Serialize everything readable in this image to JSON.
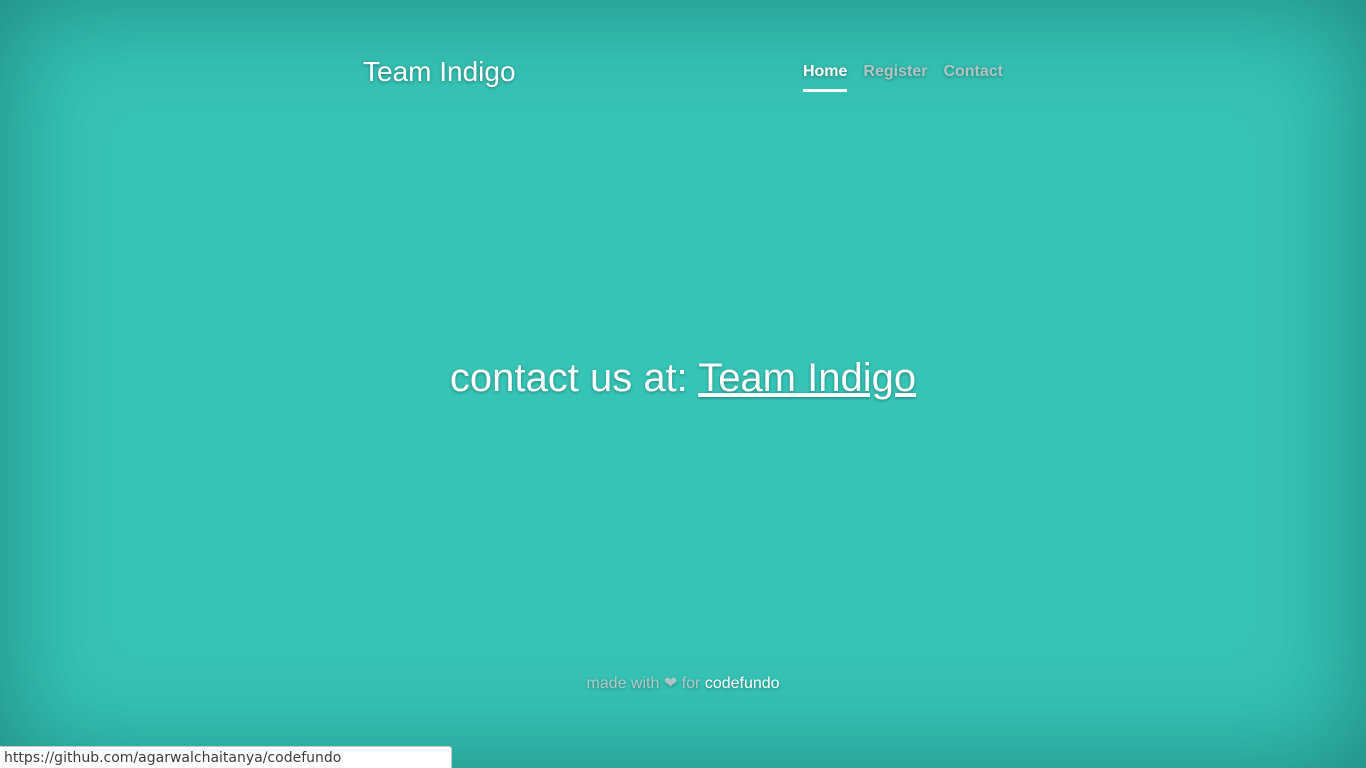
{
  "header": {
    "brand": "Team Indigo",
    "nav": [
      {
        "label": "Home",
        "active": true
      },
      {
        "label": "Register",
        "active": false
      },
      {
        "label": "Contact",
        "active": false
      }
    ]
  },
  "main": {
    "contact_prefix": "contact us at: ",
    "contact_link": "Team Indigo"
  },
  "footer": {
    "made_with": "made with",
    "heart": "❤",
    "for": "for",
    "link": "codefundo"
  },
  "status_bar": {
    "url": "https://github.com/agarwalchaitanya/codefundo"
  },
  "colors": {
    "background": "#36c4b6",
    "text": "#ffffff",
    "muted_text": "#c8cdcd"
  }
}
